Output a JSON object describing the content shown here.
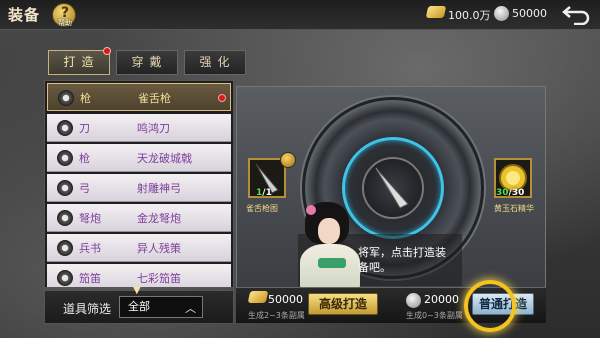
{
  "header": {
    "title": "装备",
    "help_label": "帮助",
    "gold": "100.0万",
    "silver": "50000"
  },
  "tabs": [
    {
      "label": "打造",
      "active": true,
      "badge": true
    },
    {
      "label": "穿戴",
      "active": false
    },
    {
      "label": "强化",
      "active": false
    }
  ],
  "equipment_list": [
    {
      "type": "枪",
      "name": "雀舌枪",
      "selected": true,
      "badge": true,
      "icon": "spear-icon"
    },
    {
      "type": "刀",
      "name": "鸣鸿刀",
      "icon": "blade-icon"
    },
    {
      "type": "枪",
      "name": "天龙破城戟",
      "icon": "halberd-icon"
    },
    {
      "type": "弓",
      "name": "射雕神弓",
      "icon": "bow-icon"
    },
    {
      "type": "弩炮",
      "name": "金龙弩炮",
      "icon": "crossbow-icon"
    },
    {
      "type": "兵书",
      "name": "异人残策",
      "icon": "book-icon"
    },
    {
      "type": "笳笛",
      "name": "七彩笳笛",
      "icon": "flute-icon"
    }
  ],
  "filter": {
    "label": "道具筛选",
    "selected": "全部"
  },
  "forge": {
    "left_material": {
      "name": "雀舌枪图",
      "have": "1",
      "need": "1"
    },
    "right_material": {
      "name": "黄玉石精华",
      "have": "30",
      "need": "30"
    },
    "dialog": "将军，点击打造装备吧。"
  },
  "actions": {
    "advanced": {
      "cost": "50000",
      "label": "高级打造",
      "note": "生成2~3条副属"
    },
    "normal": {
      "cost": "20000",
      "label": "普通打造",
      "note": "生成0~3条副属"
    }
  },
  "colors": {
    "accent_gold": "#c39b35",
    "ring_cyan": "#3ec4e6",
    "item_purple": "#7c3f9a",
    "badge_red": "#d21e1e"
  }
}
